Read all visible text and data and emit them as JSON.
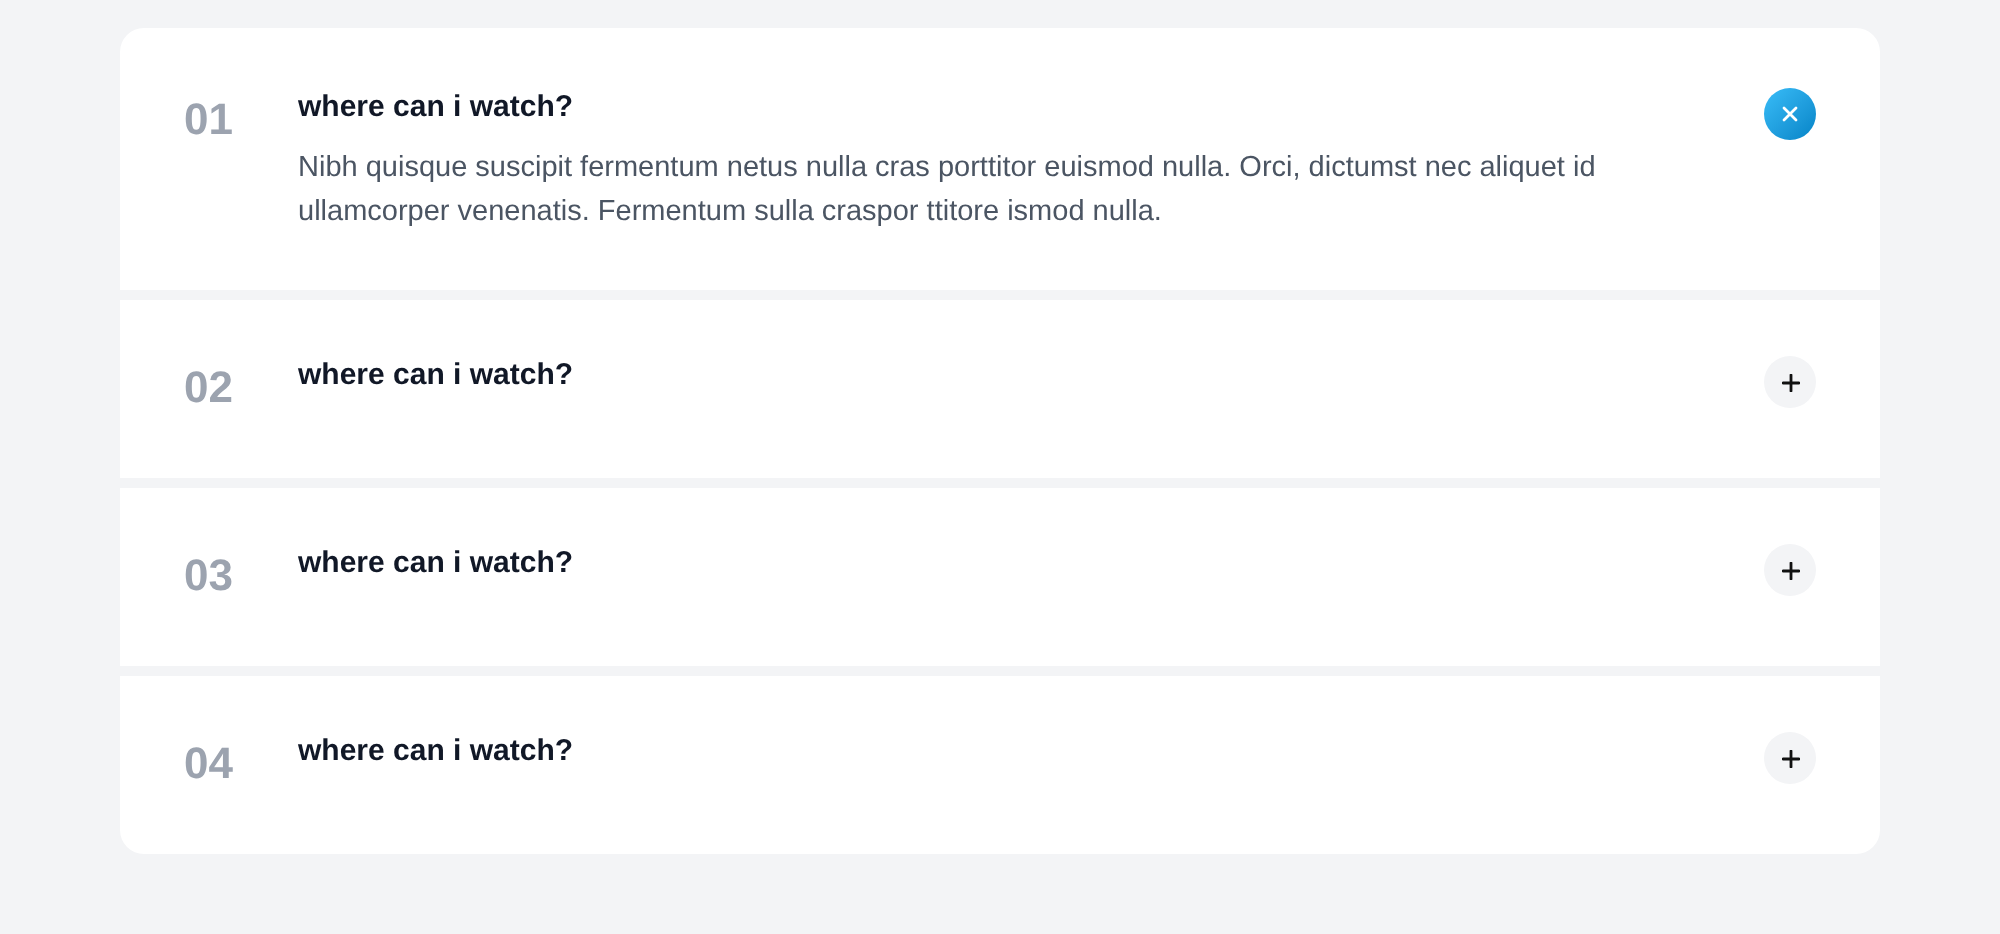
{
  "faq": [
    {
      "number": "01",
      "question": "where can i watch?",
      "expanded": true,
      "answer": "Nibh quisque suscipit fermentum netus nulla cras porttitor euismod nulla. Orci, dictumst nec aliquet id ullamcorper venenatis. Fermentum sulla craspor ttitore ismod nulla."
    },
    {
      "number": "02",
      "question": "where can i watch?",
      "expanded": false
    },
    {
      "number": "03",
      "question": "where can i watch?",
      "expanded": false
    },
    {
      "number": "04",
      "question": "where can i watch?",
      "expanded": false
    }
  ]
}
